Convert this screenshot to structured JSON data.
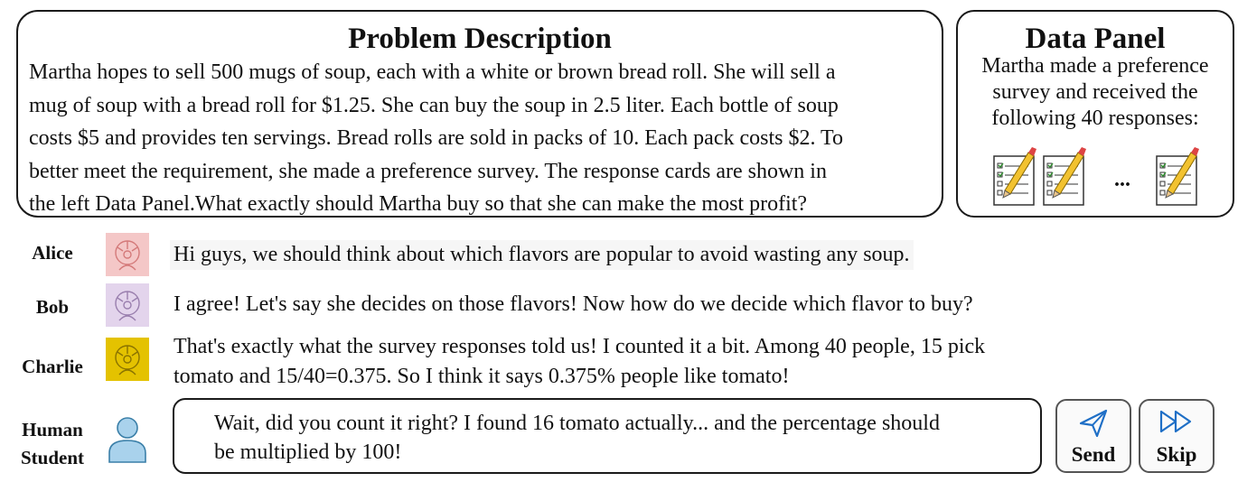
{
  "problem": {
    "title": "Problem Description",
    "lines": [
      "Martha hopes to sell 500 mugs of soup, each with a white or brown bread roll. She will sell a",
      "mug of soup with a bread roll for $1.25.  She can buy the soup in  2.5 liter. Each bottle of soup",
      "costs $5 and provides ten servings.  Bread rolls are sold in packs of 10. Each pack costs $2. To",
      "better meet the requirement, she made a preference survey. The response cards are shown in",
      "the left Data Panel.What exactly should Martha buy so that she can make the most profit?"
    ]
  },
  "data_panel": {
    "title": "Data Panel",
    "lines": [
      "Martha made a preference",
      "survey and received the",
      "following 40 responses:"
    ],
    "ellipsis": "..."
  },
  "chat": {
    "alice": {
      "name": "Alice",
      "message": "Hi guys, we should think about which flavors are popular to avoid wasting any soup.",
      "color": "#f4c7c7"
    },
    "bob": {
      "name": "Bob",
      "message": "I agree! Let's say she decides on those flavors! Now how do we decide which flavor to buy?",
      "color": "#e3d4ec"
    },
    "charlie": {
      "name": "Charlie",
      "lines": [
        "That's exactly what the survey responses told us! I counted it a bit. Among 40 people, 15 pick",
        "tomato and 15/40=0.375. So I think it says 0.375% people like tomato!"
      ],
      "color": "#e4c200"
    }
  },
  "human": {
    "name_line1": "Human",
    "name_line2": "Student",
    "reply_lines": [
      "Wait, did you count it right? I found 16 tomato actually... and the percentage should",
      "be multiplied by 100!"
    ],
    "color": "#a9d2ec"
  },
  "buttons": {
    "send": "Send",
    "skip": "Skip",
    "accent": "#1f6fc6"
  }
}
